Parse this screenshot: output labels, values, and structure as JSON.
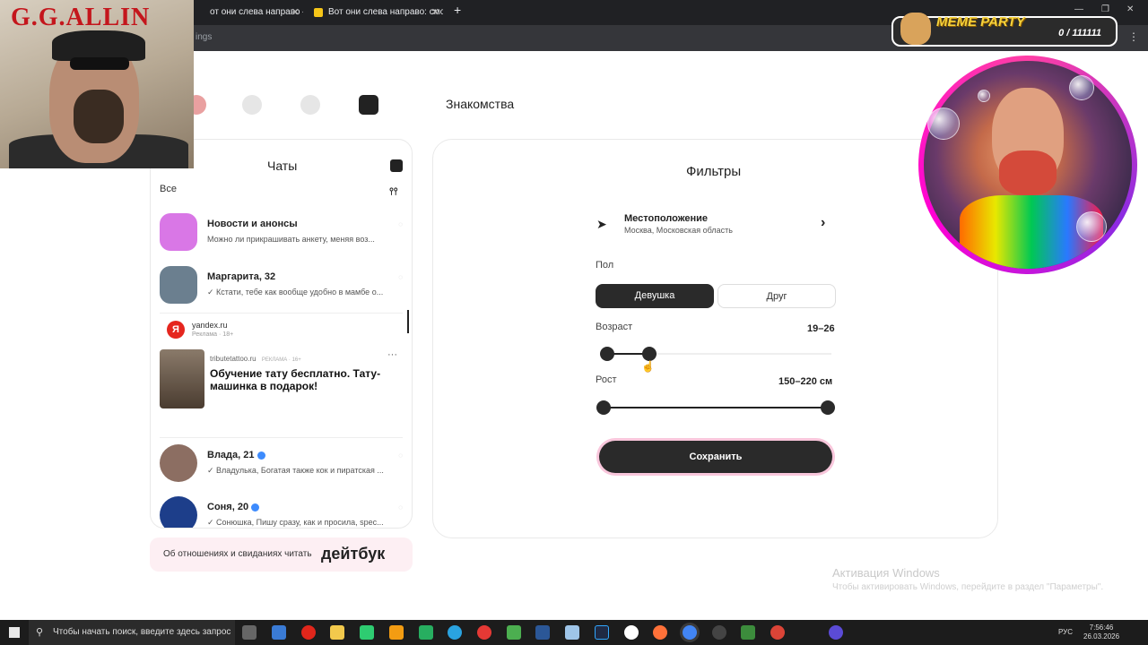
{
  "browser": {
    "tabs": [
      {
        "title": "от они слева направо — Янд"
      },
      {
        "title": "Вот они слева направо: смотр"
      }
    ],
    "new_tab_label": "+",
    "address_fragment": "ings"
  },
  "overlays": {
    "left_cam_title": "G.G.ALLIN",
    "meme_title": "MEME PARTY",
    "meme_counter": "0 / 111111"
  },
  "nav": {
    "title": "Знакомства"
  },
  "chats": {
    "title": "Чаты",
    "filter": "Все",
    "items": [
      {
        "name": "Новости и анонсы",
        "preview": "Можно ли прикрашивать анкету, меняя воз...",
        "avatar_color": "#d977e6"
      },
      {
        "name": "Маргарита, 32",
        "preview": "✓ Кстати, тебе как вообще удобно в мамбе о...",
        "avatar_color": "#6b7f8f"
      },
      {
        "name": "Влада, 21",
        "preview": "✓ Владулька, Богатая также кок и пиратская ...",
        "avatar_color": "#8c6e62"
      },
      {
        "name": "Соня, 20",
        "preview": "✓ Сонюшка, Пишу сразу, как и просила, spec...",
        "avatar_color": "#1d3e8a"
      }
    ],
    "ad": {
      "logo": "Я",
      "domain": "yandex.ru",
      "sub": "Реклама · 18+",
      "site": "tributetattoo.ru",
      "badge": "РЕКЛАМА · 16+",
      "more": "···",
      "headline": "Обучение тату бесплатно. Тату-машинка в подарок!"
    }
  },
  "promo": {
    "text": "Об отношениях и свиданиях читать",
    "logo": "дейтбук"
  },
  "filters": {
    "title": "Фильтры",
    "location": {
      "label": "Местоположение",
      "value": "Москва, Московская область"
    },
    "gender": {
      "label": "Пол",
      "options": [
        "Девушка",
        "Друг"
      ],
      "selected": "Девушка"
    },
    "age": {
      "label": "Возраст",
      "value": "19–26",
      "min": 19,
      "max": 26
    },
    "height": {
      "label": "Рост",
      "value": "150–220  см",
      "min": 150,
      "max": 220
    },
    "save_label": "Сохранить"
  },
  "windows": {
    "activation_title": "Активация Windows",
    "activation_sub": "Чтобы активировать Windows, перейдите в раздел \"Параметры\".",
    "search_placeholder": "Чтобы начать поиск, введите здесь запрос",
    "lang": "РУС",
    "time": "7:56:46",
    "date": "26.03.2026"
  },
  "colors": {
    "accent_dark": "#2a2a2a",
    "promo_bg": "#fdeff3",
    "save_glow": "#f9c7dc"
  }
}
